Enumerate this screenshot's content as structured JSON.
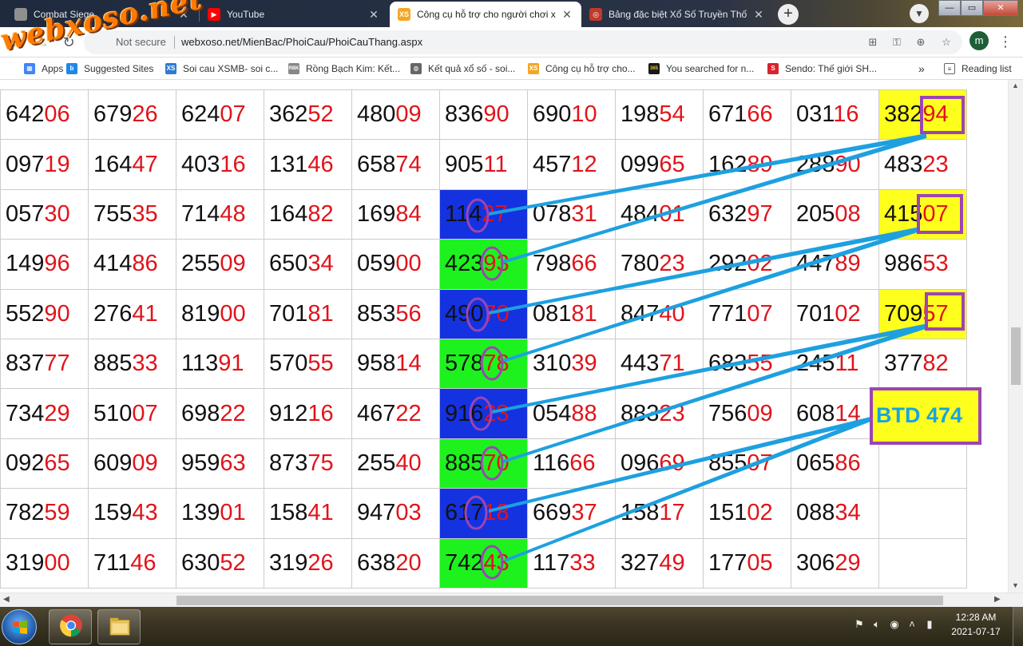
{
  "watermark": "webxoso.net",
  "tabs": [
    {
      "title": "Combat Siege",
      "icon": "combat-siege-favicon-icon",
      "active": false,
      "icon_color": "#8f8f8f",
      "icon_text": ""
    },
    {
      "title": "YouTube",
      "icon": "youtube-icon",
      "active": false,
      "icon_color": "#ff0000",
      "icon_text": "▶"
    },
    {
      "title": "Công cụ hỗ trợ cho người chơi xổ",
      "icon": "xs-favicon-icon",
      "active": true,
      "icon_color": "#f5a623",
      "icon_text": "XS"
    },
    {
      "title": "Bảng đặc biệt Xổ Số Truyền Thốn",
      "icon": "xoso-favicon-icon",
      "active": false,
      "icon_color": "#c0392b",
      "icon_text": "◎"
    }
  ],
  "new_tab_label": "+",
  "window": {
    "minimize": "—",
    "maximize": "▭",
    "close": "✕"
  },
  "toolbar": {
    "back": "←",
    "forward": "→",
    "reload": "↻",
    "security": "Not secure",
    "url": "webxoso.net/MienBac/PhoiCau/PhoiCauThang.aspx",
    "avatar_letter": "m",
    "menu": "⋮"
  },
  "bookmarks": [
    {
      "label": "Apps",
      "icon": "apps-icon",
      "color": "#4285f4",
      "text": "▦"
    },
    {
      "label": "Suggested Sites",
      "icon": "bing-icon",
      "color": "#1e88e5",
      "text": "b"
    },
    {
      "label": "Soi cau XSMB- soi c...",
      "icon": "xs-icon",
      "color": "#2e7bd1",
      "text": "XS"
    },
    {
      "label": "Rồng Bạch Kim: Kết...",
      "icon": "rbk-icon",
      "color": "#888888",
      "text": "RBK"
    },
    {
      "label": "Kết quả xổ số - soi...",
      "icon": "globe-icon",
      "color": "#666666",
      "text": "◍"
    },
    {
      "label": "Công cụ hỗ trợ cho...",
      "icon": "xs-orange-icon",
      "color": "#f5a623",
      "text": "XS"
    },
    {
      "label": "You searched for n...",
      "icon": "365-icon",
      "color": "#1a1a1a",
      "text": "365"
    },
    {
      "label": "Sendo: Thế giới SH...",
      "icon": "sendo-icon",
      "color": "#d9232d",
      "text": "S"
    }
  ],
  "bookmarks_more": "»",
  "reading_list": "Reading list",
  "grid": {
    "rows": [
      [
        {
          "h": "642",
          "t": "06"
        },
        {
          "h": "679",
          "t": "26"
        },
        {
          "h": "624",
          "t": "07"
        },
        {
          "h": "362",
          "t": "52"
        },
        {
          "h": "480",
          "t": "09"
        },
        {
          "h": "836",
          "t": "90"
        },
        {
          "h": "690",
          "t": "10"
        },
        {
          "h": "198",
          "t": "54"
        },
        {
          "h": "671",
          "t": "66"
        },
        {
          "h": "031",
          "t": "16"
        },
        {
          "h": "382",
          "t": "94"
        }
      ],
      [
        {
          "h": "097",
          "t": "19"
        },
        {
          "h": "164",
          "t": "47"
        },
        {
          "h": "403",
          "t": "16"
        },
        {
          "h": "131",
          "t": "46"
        },
        {
          "h": "658",
          "t": "74"
        },
        {
          "h": "905",
          "t": "11"
        },
        {
          "h": "457",
          "t": "12"
        },
        {
          "h": "099",
          "t": "65"
        },
        {
          "h": "162",
          "t": "89"
        },
        {
          "h": "288",
          "t": "90"
        },
        {
          "h": "483",
          "t": "23"
        }
      ],
      [
        {
          "h": "057",
          "t": "30"
        },
        {
          "h": "755",
          "t": "35"
        },
        {
          "h": "714",
          "t": "48"
        },
        {
          "h": "164",
          "t": "82"
        },
        {
          "h": "169",
          "t": "84"
        },
        {
          "h": "114",
          "t": "27"
        },
        {
          "h": "078",
          "t": "31"
        },
        {
          "h": "484",
          "t": "01"
        },
        {
          "h": "632",
          "t": "97"
        },
        {
          "h": "205",
          "t": "08"
        },
        {
          "h": "415",
          "t": "07"
        }
      ],
      [
        {
          "h": "149",
          "t": "96"
        },
        {
          "h": "414",
          "t": "86"
        },
        {
          "h": "255",
          "t": "09"
        },
        {
          "h": "650",
          "t": "34"
        },
        {
          "h": "059",
          "t": "00"
        },
        {
          "h": "423",
          "t": "93"
        },
        {
          "h": "798",
          "t": "66"
        },
        {
          "h": "780",
          "t": "23"
        },
        {
          "h": "292",
          "t": "02"
        },
        {
          "h": "447",
          "t": "89"
        },
        {
          "h": "986",
          "t": "53"
        }
      ],
      [
        {
          "h": "552",
          "t": "90"
        },
        {
          "h": "276",
          "t": "41"
        },
        {
          "h": "819",
          "t": "00"
        },
        {
          "h": "701",
          "t": "81"
        },
        {
          "h": "853",
          "t": "56"
        },
        {
          "h": "490",
          "t": "70"
        },
        {
          "h": "081",
          "t": "81"
        },
        {
          "h": "847",
          "t": "40"
        },
        {
          "h": "771",
          "t": "07"
        },
        {
          "h": "701",
          "t": "02"
        },
        {
          "h": "709",
          "t": "57"
        }
      ],
      [
        {
          "h": "837",
          "t": "77"
        },
        {
          "h": "885",
          "t": "33"
        },
        {
          "h": "113",
          "t": "91"
        },
        {
          "h": "570",
          "t": "55"
        },
        {
          "h": "958",
          "t": "14"
        },
        {
          "h": "578",
          "t": "78"
        },
        {
          "h": "310",
          "t": "39"
        },
        {
          "h": "443",
          "t": "71"
        },
        {
          "h": "683",
          "t": "55"
        },
        {
          "h": "245",
          "t": "11"
        },
        {
          "h": "377",
          "t": "82"
        }
      ],
      [
        {
          "h": "734",
          "t": "29"
        },
        {
          "h": "510",
          "t": "07"
        },
        {
          "h": "698",
          "t": "22"
        },
        {
          "h": "912",
          "t": "16"
        },
        {
          "h": "467",
          "t": "22"
        },
        {
          "h": "916",
          "t": "23"
        },
        {
          "h": "054",
          "t": "88"
        },
        {
          "h": "883",
          "t": "23"
        },
        {
          "h": "756",
          "t": "09"
        },
        {
          "h": "608",
          "t": "14"
        },
        {
          "h": "",
          "t": ""
        }
      ],
      [
        {
          "h": "092",
          "t": "65"
        },
        {
          "h": "609",
          "t": "09"
        },
        {
          "h": "959",
          "t": "63"
        },
        {
          "h": "873",
          "t": "75"
        },
        {
          "h": "255",
          "t": "40"
        },
        {
          "h": "885",
          "t": "70"
        },
        {
          "h": "116",
          "t": "66"
        },
        {
          "h": "096",
          "t": "69"
        },
        {
          "h": "855",
          "t": "07"
        },
        {
          "h": "065",
          "t": "86"
        },
        {
          "h": "",
          "t": ""
        }
      ],
      [
        {
          "h": "782",
          "t": "59"
        },
        {
          "h": "159",
          "t": "43"
        },
        {
          "h": "139",
          "t": "01"
        },
        {
          "h": "158",
          "t": "41"
        },
        {
          "h": "947",
          "t": "03"
        },
        {
          "h": "617",
          "t": "18"
        },
        {
          "h": "669",
          "t": "37"
        },
        {
          "h": "158",
          "t": "17"
        },
        {
          "h": "151",
          "t": "02"
        },
        {
          "h": "088",
          "t": "34"
        },
        {
          "h": "",
          "t": ""
        }
      ],
      [
        {
          "h": "319",
          "t": "00"
        },
        {
          "h": "711",
          "t": "46"
        },
        {
          "h": "630",
          "t": "52"
        },
        {
          "h": "319",
          "t": "26"
        },
        {
          "h": "638",
          "t": "20"
        },
        {
          "h": "742",
          "t": "43"
        },
        {
          "h": "117",
          "t": "33"
        },
        {
          "h": "327",
          "t": "49"
        },
        {
          "h": "177",
          "t": "05"
        },
        {
          "h": "306",
          "t": "29"
        },
        {
          "h": "",
          "t": ""
        }
      ]
    ],
    "highlight_colors": {
      "blue": "#1432e0",
      "green": "#1ef21e",
      "yellow": "#ffff1e"
    },
    "col6_pattern": [
      "",
      "",
      "blue",
      "green",
      "blue",
      "green",
      "blue",
      "green",
      "blue",
      "green"
    ],
    "col11_yellow_rows": [
      0,
      2,
      4
    ]
  },
  "annotation": {
    "btd_label": "BTD 474",
    "line_color": "#1ea0e0",
    "circle_color": "#9b45b4"
  },
  "taskbar": {
    "time": "12:28 AM",
    "date": "2021-07-17"
  }
}
